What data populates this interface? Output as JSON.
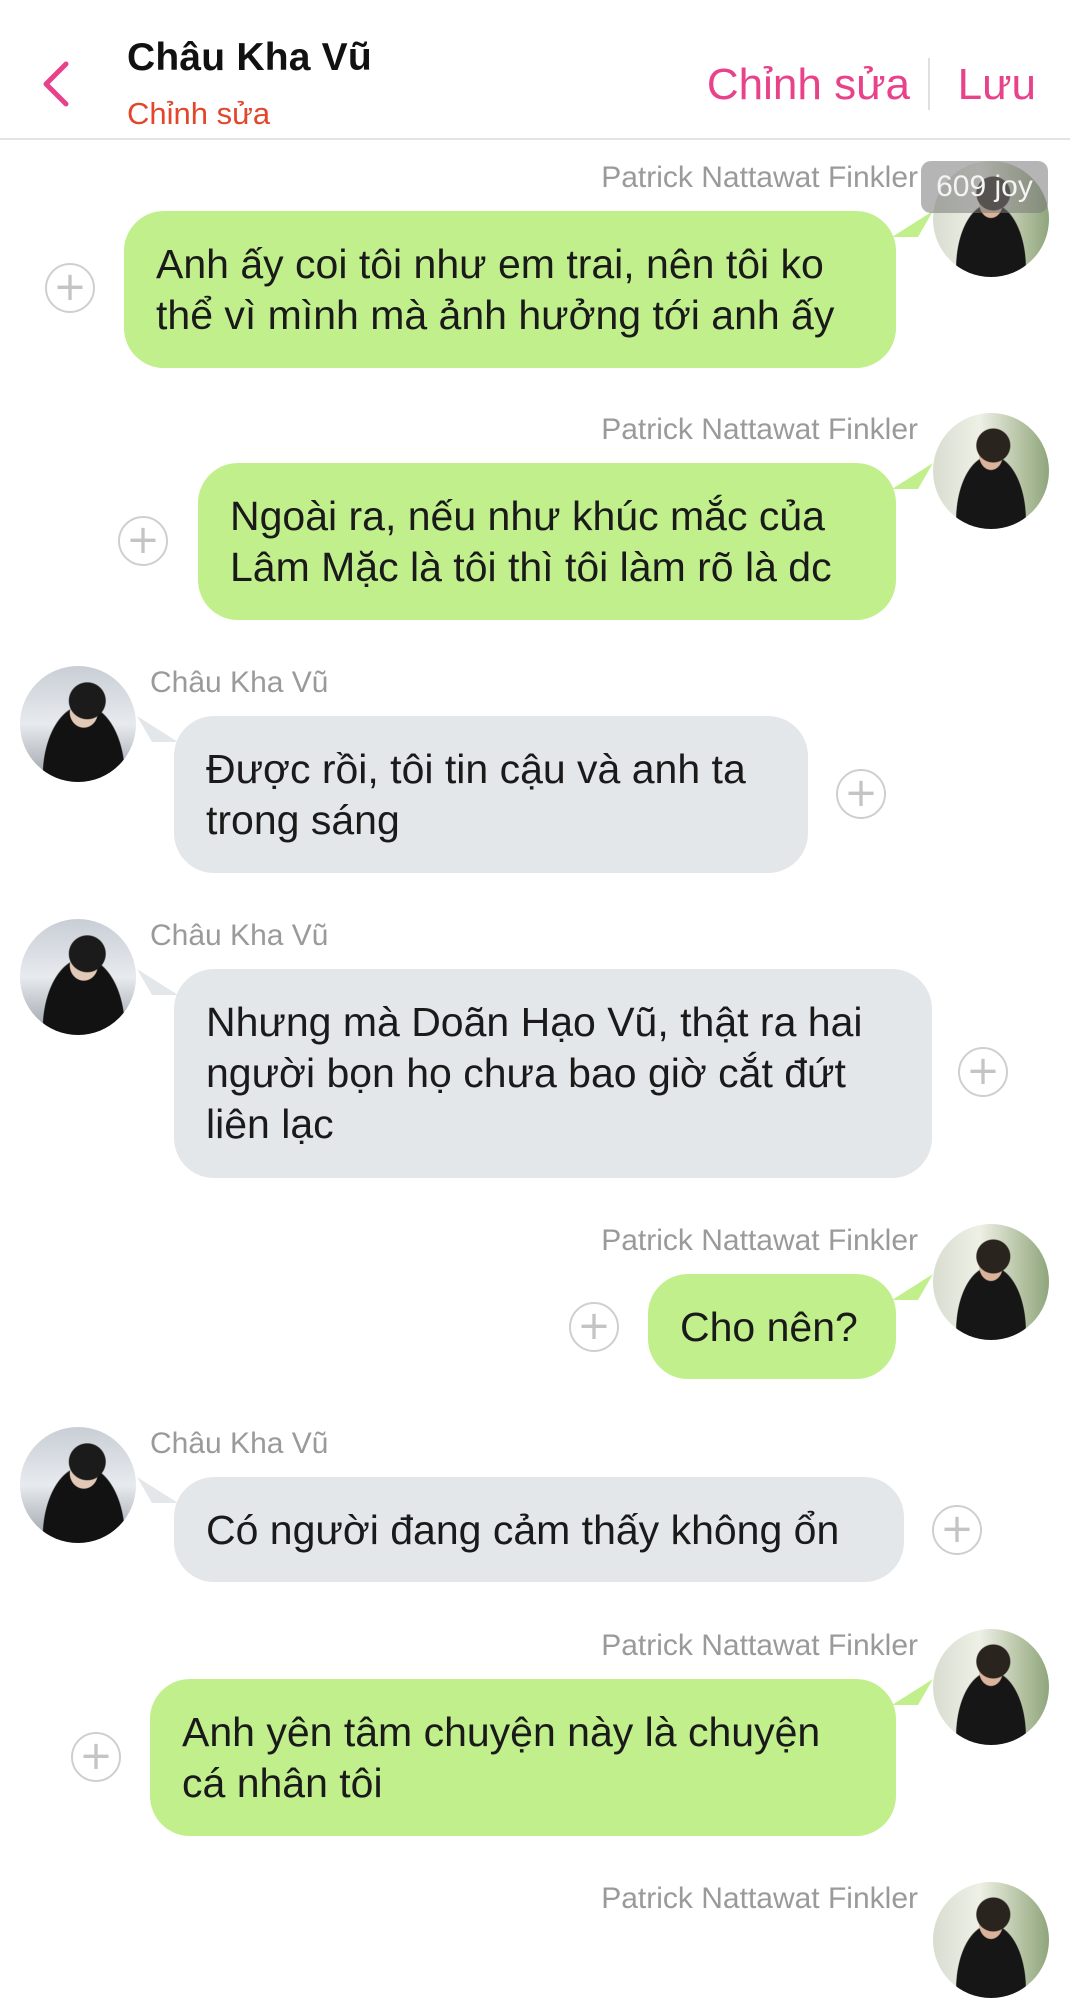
{
  "header": {
    "title": "Châu Kha Vũ",
    "subtitle": "Chỉnh sửa",
    "edit_label": "Chỉnh sửa",
    "save_label": "Lưu",
    "accent_color": "#e8428a",
    "subtitle_color": "#e2462b"
  },
  "watermark": "609 joy",
  "messages": [
    {
      "sender": "Patrick Nattawat Finkler",
      "side": "right",
      "text": "Anh ấy coi tôi như em trai, nên tôi ko\nthể vì mình mà ảnh hưởng tới anh ấy"
    },
    {
      "sender": "Patrick Nattawat Finkler",
      "side": "right",
      "text": "Ngoài ra, nếu như khúc mắc của\nLâm Mặc là tôi thì tôi làm rõ là dc"
    },
    {
      "sender": "Châu Kha Vũ",
      "side": "left",
      "text": "Được rồi, tôi tin cậu và anh ta\ntrong sáng"
    },
    {
      "sender": "Châu Kha Vũ",
      "side": "left",
      "text": "Nhưng mà Doãn Hạo Vũ, thật ra hai\nngười bọn họ chưa bao giờ cắt đứt\nliên lạc"
    },
    {
      "sender": "Patrick Nattawat Finkler",
      "side": "right",
      "text": "Cho nên?"
    },
    {
      "sender": "Châu Kha Vũ",
      "side": "left",
      "text": "Có người đang cảm thấy không ổn"
    },
    {
      "sender": "Patrick Nattawat Finkler",
      "side": "right",
      "text": "Anh yên tâm chuyện này là chuyện\ncá nhân tôi"
    },
    {
      "sender": "Patrick Nattawat Finkler",
      "side": "right",
      "text": ""
    }
  ],
  "colors": {
    "bubble_right": "#c0ef8c",
    "bubble_left": "#e3e7ea"
  },
  "icons": {
    "back": "chevron-left-icon",
    "add": "plus-circle-icon"
  }
}
